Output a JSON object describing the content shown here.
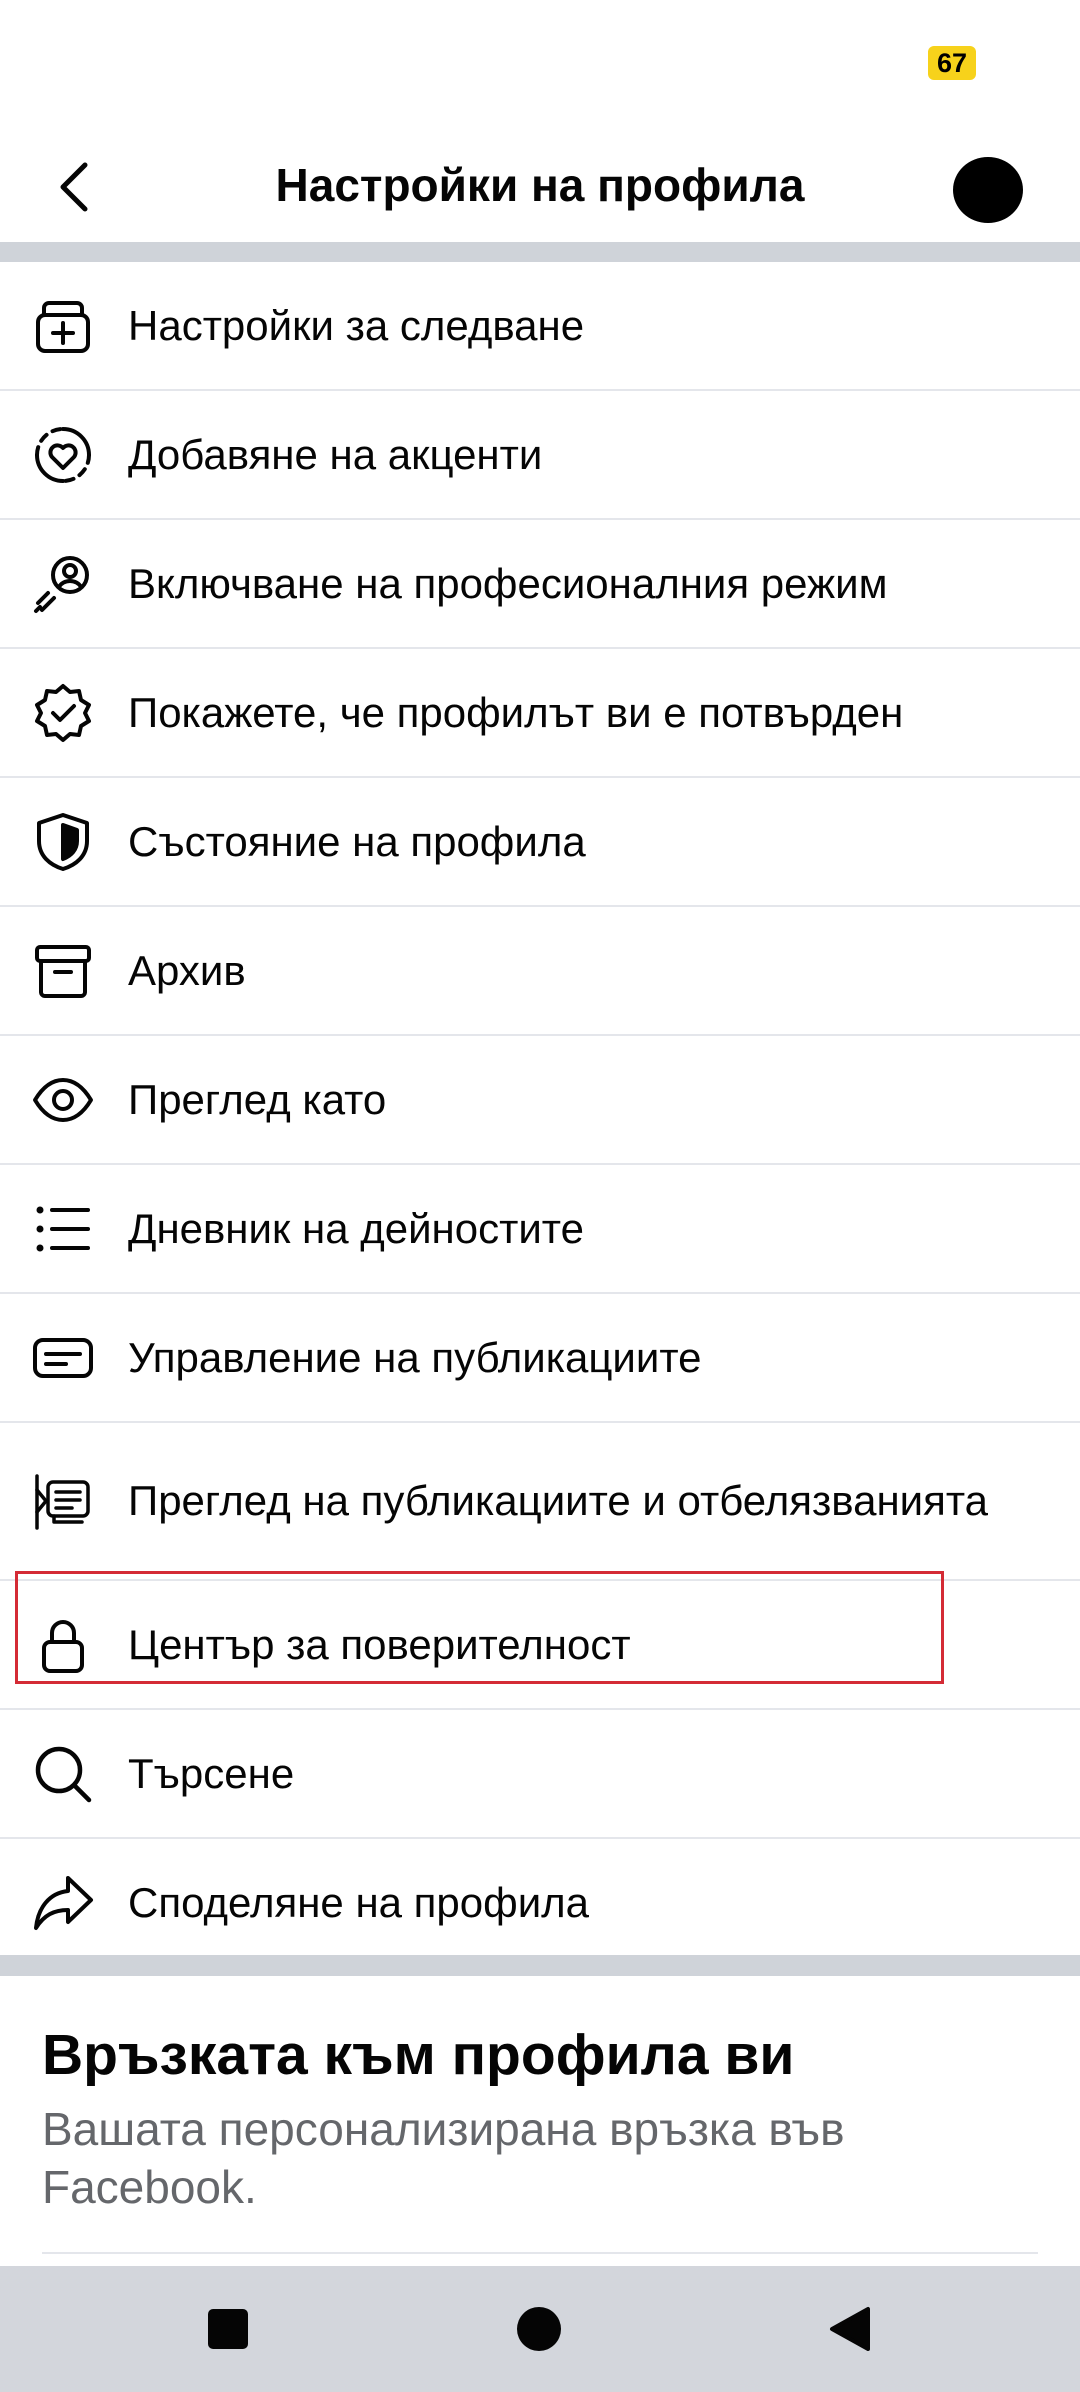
{
  "status_bar": {
    "battery_level": "67"
  },
  "header": {
    "title": "Настройки на профила"
  },
  "menu": {
    "items": [
      {
        "label": "Настройки за следване",
        "icon": "follow-settings-icon"
      },
      {
        "label": "Добавяне на акценти",
        "icon": "highlight-heart-icon"
      },
      {
        "label": "Включване на професионалния режим",
        "icon": "professional-mode-icon"
      },
      {
        "label": "Покажете, че профилът ви е потвърден",
        "icon": "verified-badge-icon"
      },
      {
        "label": "Състояние на профила",
        "icon": "shield-icon"
      },
      {
        "label": "Архив",
        "icon": "archive-icon"
      },
      {
        "label": "Преглед като",
        "icon": "eye-icon"
      },
      {
        "label": "Дневник на дейностите",
        "icon": "list-icon"
      },
      {
        "label": "Управление на публикациите",
        "icon": "manage-posts-icon"
      },
      {
        "label": "Преглед на публикациите и отбелязванията",
        "icon": "review-posts-icon"
      },
      {
        "label": "Център за поверителност",
        "icon": "lock-icon"
      },
      {
        "label": "Търсене",
        "icon": "search-icon"
      },
      {
        "label": "Споделяне на профила",
        "icon": "share-icon"
      }
    ]
  },
  "profile_link": {
    "title": "Връзката към профила ви",
    "description": "Вашата персонализирана връзка във Facebook."
  },
  "colors": {
    "highlight": "#d42b35",
    "divider": "#cfd3d9",
    "battery": "#f7d21b"
  }
}
